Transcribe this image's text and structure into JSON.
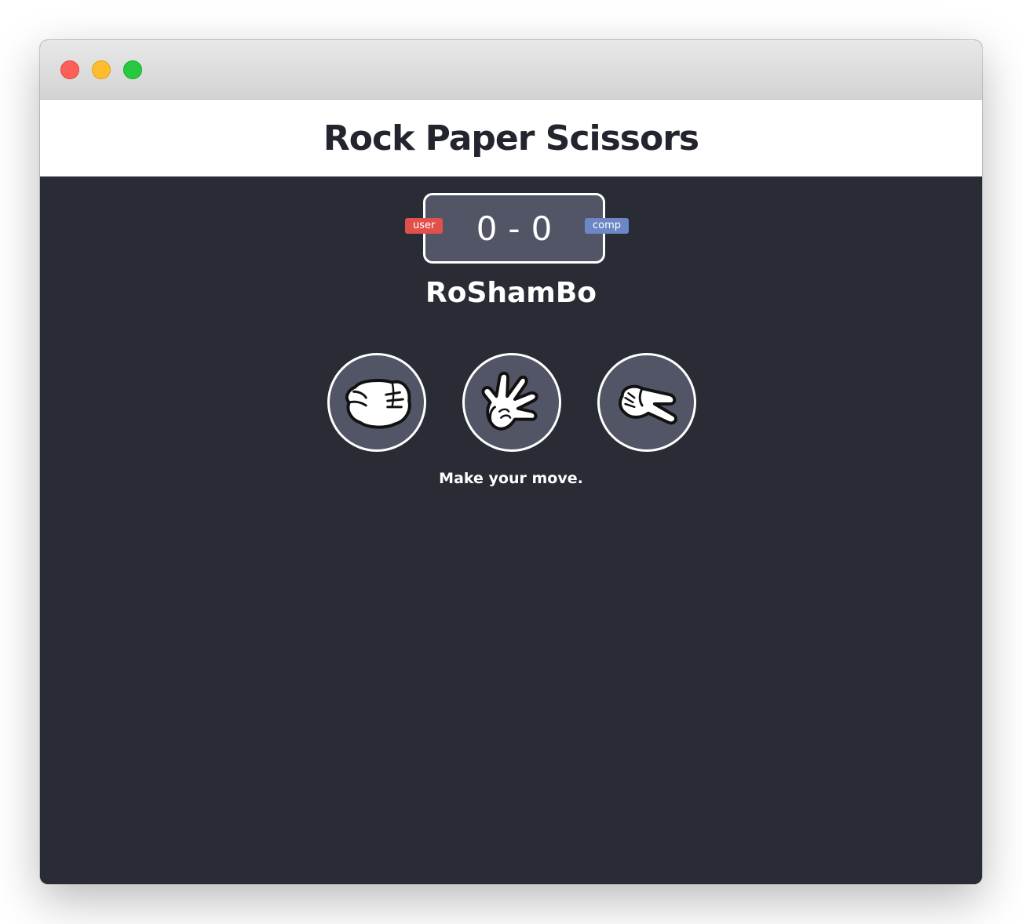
{
  "window": {
    "controls": [
      {
        "name": "close-button",
        "color": "#fe5f57"
      },
      {
        "name": "minimize-button",
        "color": "#febc2e"
      },
      {
        "name": "zoom-button",
        "color": "#28c840"
      }
    ]
  },
  "header": {
    "title": "Rock Paper Scissors"
  },
  "scoreboard": {
    "user_label": "user",
    "comp_label": "comp",
    "user_score": "0",
    "separator": "-",
    "comp_score": "0",
    "user_color": "#e2504c",
    "comp_color": "#6c87c4"
  },
  "game": {
    "subtitle": "RoShamBo",
    "choices": [
      {
        "id": "r",
        "icon": "rock-fist-icon"
      },
      {
        "id": "p",
        "icon": "paper-hand-icon"
      },
      {
        "id": "s",
        "icon": "scissors-hand-icon"
      }
    ],
    "message": "Make your move."
  },
  "colors": {
    "background": "#292b35",
    "panel": "#525566",
    "header_bg": "#ffffff",
    "title_text": "#23252e"
  }
}
